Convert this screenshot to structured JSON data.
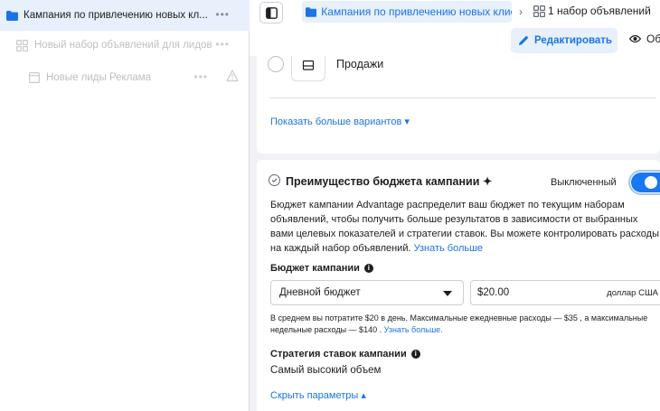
{
  "sidebar": {
    "campaign": {
      "label": "Кампания по привлечению новых кл...",
      "more": "•••"
    },
    "adset": {
      "label": "Новый набор объявлений для лидов",
      "more": "•••"
    },
    "ad": {
      "label": "Новые лиды Реклама",
      "more": "•••"
    }
  },
  "topbar": {
    "campaign_crumb": "Кампания по привлечению новых клиен",
    "separator": "›",
    "adset_crumb": "1 набор объявлений",
    "edit_label": "Редактировать",
    "view_label": "Об"
  },
  "objective": {
    "option_label": "Продажи",
    "show_more": "Показать больше вариантов ▾"
  },
  "budget_advantage": {
    "title": "Преимущество бюджета кампании ✦",
    "toggle_label": "Выключенный",
    "toggle_on": true,
    "description": "Бюджет кампании Advantage распределит ваш бюджет по текущим наборам объявлений, чтобы получить больше результатов в зависимости от выбранных вами целевых показателей и стратегии ставок. Вы можете контролировать расходы на каждый набор объявлений.",
    "learn_more": "Узнать больше",
    "budget_label": "Бюджет кампании",
    "budget_type": "Дневной бюджет",
    "amount": "$20.00",
    "currency": "доллар США",
    "hint": "В среднем вы потратите $20 в день. Максимальные ежедневные расходы — $35 , а максимальные недельные расходы — $140 .",
    "hint_link": "Узнать больше.",
    "strategy_label": "Стратегия ставок кампании",
    "strategy_value": "Самый высокий объем",
    "hide_params": "Скрыть параметры ▴"
  },
  "colors": {
    "accent": "#1b74e4",
    "selected_bg": "#e7f0fb",
    "page_bg": "#f0f2f5"
  }
}
